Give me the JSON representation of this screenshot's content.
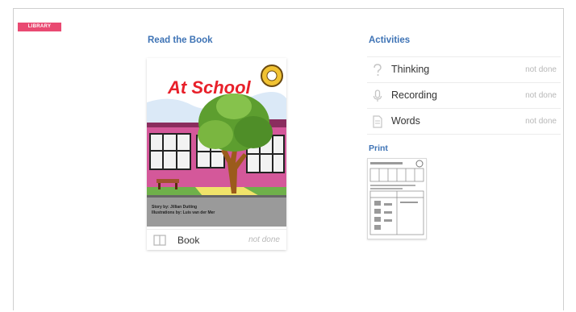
{
  "header": {
    "library_label": "LIBRARY"
  },
  "read_section": {
    "title": "Read the Book",
    "book": {
      "cover_title": "At School",
      "credit_line_1": "Story by: Jillian Dutting",
      "credit_line_2": "Illustrations by: Luis van der Mer",
      "row_label": "Book",
      "row_status": "not done",
      "row_icon": "book-icon"
    }
  },
  "activities_section": {
    "title": "Activities",
    "items": [
      {
        "label": "Thinking",
        "status": "not done",
        "icon": "question-icon"
      },
      {
        "label": "Recording",
        "status": "not done",
        "icon": "microphone-icon"
      },
      {
        "label": "Words",
        "status": "not done",
        "icon": "document-icon"
      }
    ]
  },
  "print_section": {
    "title": "Print"
  },
  "colors": {
    "accent_blue": "#3e73b5",
    "library_badge": "#e94a72",
    "cover_title_red": "#e8202a",
    "status_gray": "#b8b8b8"
  }
}
